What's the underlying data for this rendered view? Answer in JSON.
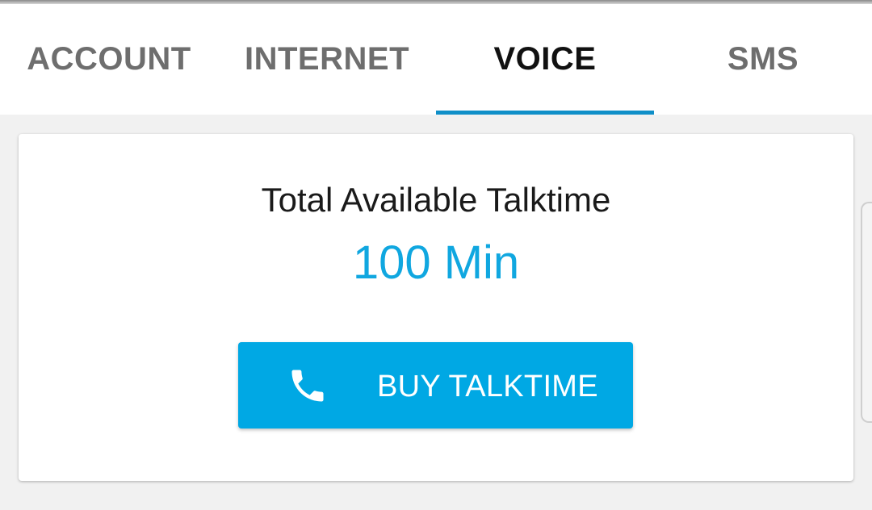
{
  "tabs": [
    {
      "label": "ACCOUNT",
      "active": false
    },
    {
      "label": "INTERNET",
      "active": false
    },
    {
      "label": "VOICE",
      "active": true
    },
    {
      "label": "SMS",
      "active": false
    }
  ],
  "voice_card": {
    "title": "Total Available Talktime",
    "value": "100 Min",
    "buy_button": {
      "label": "BUY TALKTIME",
      "icon": "phone-icon"
    }
  },
  "colors": {
    "accent": "#00a8e4",
    "tab_indicator": "#0f8fc8",
    "value_text": "#10a7e0"
  }
}
